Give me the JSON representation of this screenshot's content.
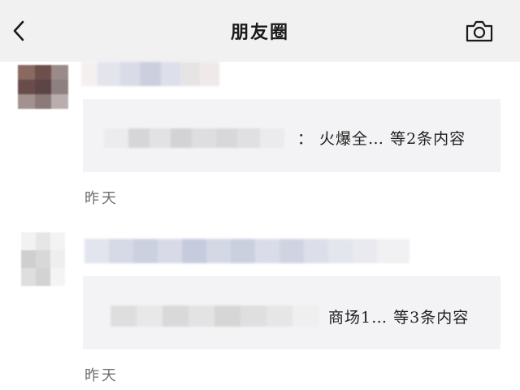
{
  "header": {
    "title": "朋友圈",
    "back_icon": "chevron-left-icon",
    "camera_icon": "camera-icon"
  },
  "posts": [
    {
      "share_text": "：  火爆全… 等2条内容",
      "time": "昨天"
    },
    {
      "share_text": "商场1… 等3条内容",
      "time": "昨天"
    }
  ]
}
